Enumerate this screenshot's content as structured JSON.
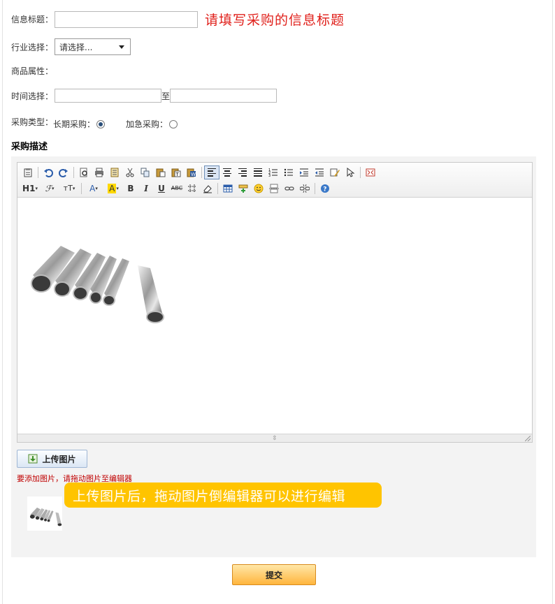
{
  "form": {
    "title_label": "信息标题：",
    "title_value": "",
    "title_hint": "请填写采购的信息标题",
    "industry_label": "行业选择：",
    "industry_selected": "请选择...",
    "attr_label": "商品属性：",
    "time_label": "时间选择：",
    "time_start": "",
    "time_sep": "至",
    "time_end": "",
    "type_label": "采购类型：",
    "type_options": [
      {
        "label": "长期采购：",
        "checked": true
      },
      {
        "label": "加急采购：",
        "checked": false
      }
    ],
    "desc_title": "采购描述"
  },
  "editor": {
    "toolbar_row1": [
      "paste-text-icon",
      "undo-icon",
      "redo-icon",
      "preview-icon",
      "print-icon",
      "template-icon",
      "cut-icon",
      "copy-icon",
      "paste-icon",
      "paste-plain-icon",
      "paste-word-icon",
      "align-left-icon",
      "align-center-icon",
      "align-right-icon",
      "justify-icon",
      "ordered-list-icon",
      "unordered-list-icon",
      "indent-icon",
      "outdent-icon",
      "clean-format-icon",
      "select-all-icon",
      "fullscreen-icon"
    ],
    "heading_label": "H1",
    "font_label": "ℱ",
    "size_label": "тT",
    "fontcolor_label": "A",
    "bgcolor_label": "A",
    "bold_label": "B",
    "italic_label": "I",
    "underline_label": "U",
    "strike_label": "ABC",
    "active_align": "left"
  },
  "upload": {
    "button_label": "上传图片",
    "note": "要添加图片，请拖动图片至编辑器",
    "callout": "上传图片后，拖动图片倒编辑器可以进行编辑"
  },
  "submit_label": "提交",
  "colors": {
    "hint_red": "#e0201b",
    "callout_bg": "#ffc400",
    "submit_orange": "#ffb53d"
  }
}
